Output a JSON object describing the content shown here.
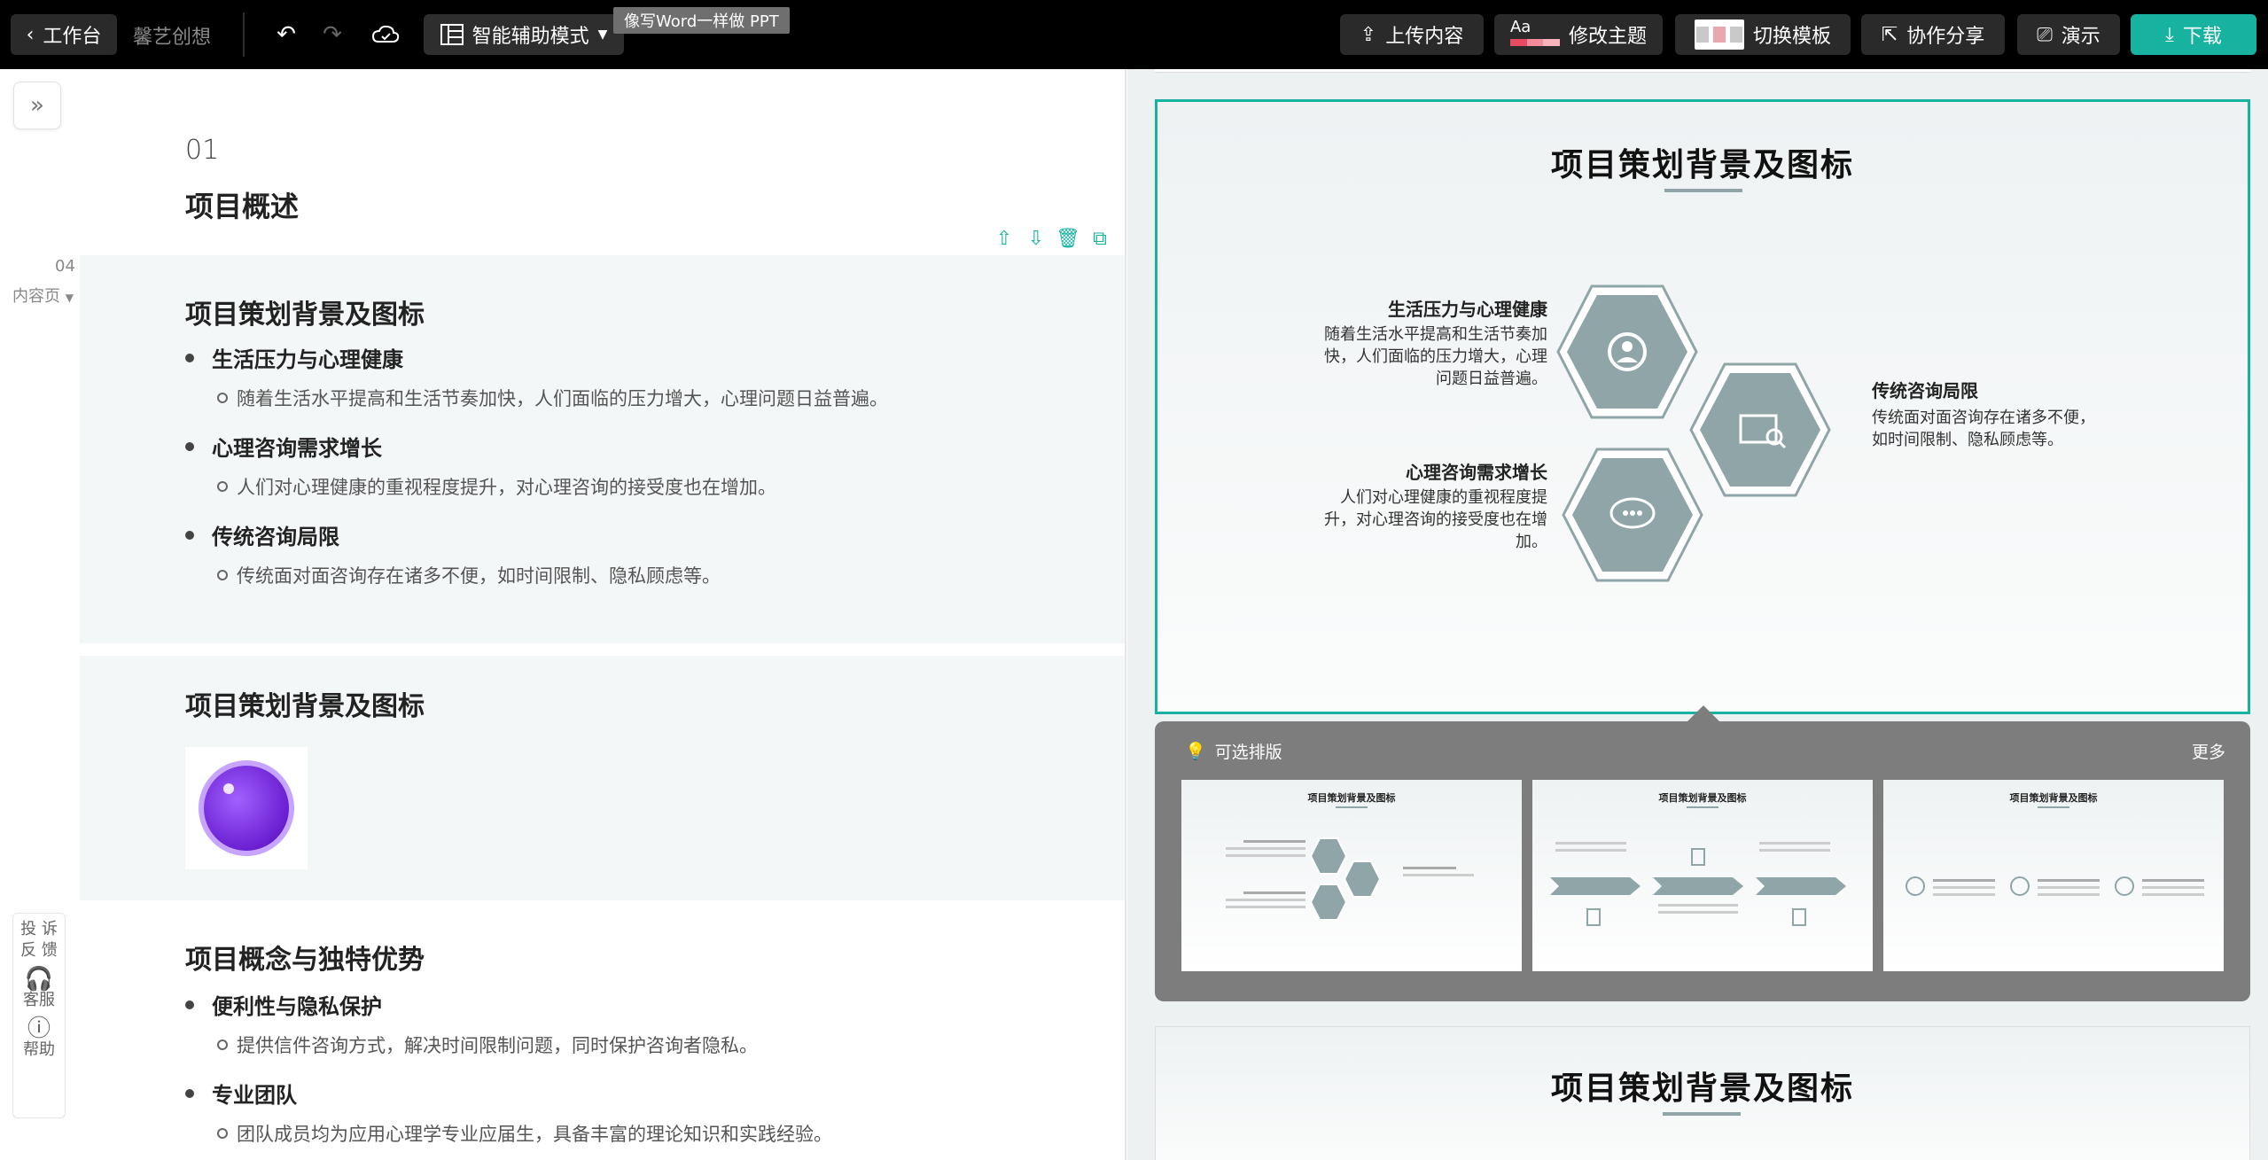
{
  "topbar": {
    "back_label": "工作台",
    "doc_name": "馨艺创想",
    "mode_label": "智能辅助模式",
    "tooltip": "像写Word一样做 PPT",
    "upload_label": "上传内容",
    "theme_aa": "Aa",
    "theme_label": "修改主题",
    "template_label": "切换模板",
    "share_label": "协作分享",
    "present_label": "演示",
    "download_label": "下载",
    "accent_color": "#17b3a0"
  },
  "editor": {
    "section_number": "01",
    "section_title": "项目概述",
    "page_number": "04",
    "page_type": "内容页",
    "block1": {
      "title": "项目策划背景及图标",
      "items": [
        {
          "label": "生活压力与心理健康",
          "detail": "随着生活水平提高和生活节奏加快，人们面临的压力增大，心理问题日益普遍。"
        },
        {
          "label": "心理咨询需求增长",
          "detail": "人们对心理健康的重视程度提升，对心理咨询的接受度也在增加。"
        },
        {
          "label": "传统咨询局限",
          "detail": "传统面对面咨询存在诸多不便，如时间限制、隐私顾虑等。"
        }
      ]
    },
    "block2": {
      "title": "项目策划背景及图标"
    },
    "block3": {
      "title": "项目概念与独特优势",
      "items": [
        {
          "label": "便利性与隐私保护",
          "detail": "提供信件咨询方式，解决时间限制问题，同时保护咨询者隐私。"
        },
        {
          "label": "专业团队",
          "detail": "团队成员均为应用心理学专业应届生，具备丰富的理论知识和实践经验。"
        }
      ]
    }
  },
  "side_tools": {
    "complaint": "投诉\n反馈",
    "complaint_l1": "投 诉",
    "complaint_l2": "反 馈",
    "service": "客服",
    "help": "帮助"
  },
  "preview": {
    "slide_title": "项目策划背景及图标",
    "items": [
      {
        "title": "生活压力与心理健康",
        "text_l1": "随着生活水平提高和生活节奏加",
        "text_l2": "快，人们面临的压力增大，心理",
        "text_l3": "问题日益普遍。"
      },
      {
        "title": "心理咨询需求增长",
        "text_l1": "人们对心理健康的重视程度提",
        "text_l2": "升，对心理咨询的接受度也在增",
        "text_l3": "加。"
      },
      {
        "title": "传统咨询局限",
        "text_l1": "传统面对面咨询存在诸多不便，",
        "text_l2": "如时间限制、隐私顾虑等。"
      }
    ],
    "hex_color": "#8fa5a8"
  },
  "layouts": {
    "header": "可选排版",
    "more": "更多",
    "thumbs": [
      {
        "title": "项目策划背景及图标"
      },
      {
        "title": "项目策划背景及图标"
      },
      {
        "title": "项目策划背景及图标"
      }
    ]
  },
  "next_slide": {
    "title": "项目策划背景及图标"
  }
}
